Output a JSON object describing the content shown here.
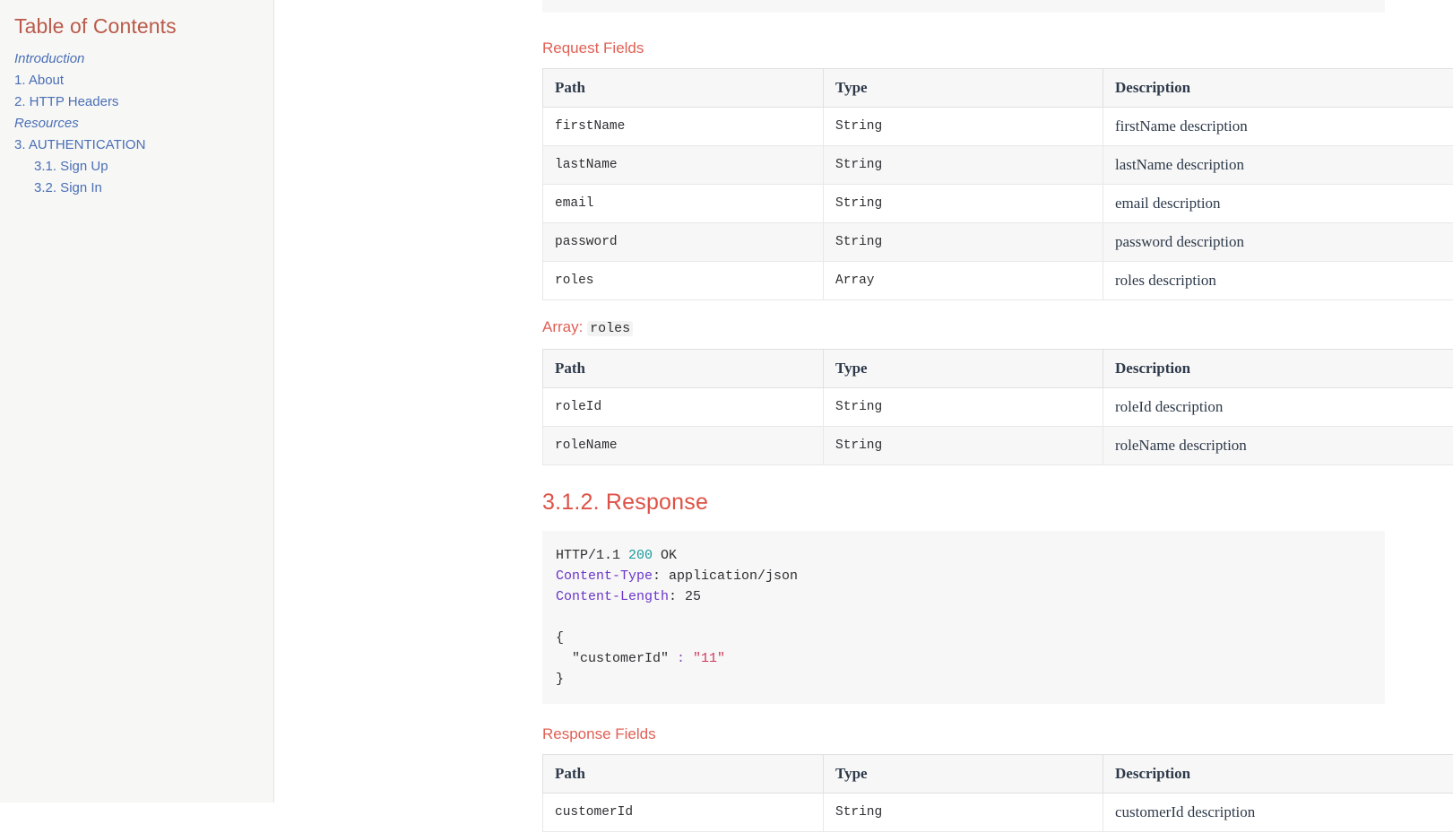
{
  "toc": {
    "title": "Table of Contents",
    "items": [
      {
        "label": "Introduction",
        "style": "italic",
        "level": 1
      },
      {
        "label": "1. About",
        "style": "link",
        "level": 1
      },
      {
        "label": "2. HTTP Headers",
        "style": "link",
        "level": 1
      },
      {
        "label": "Resources",
        "style": "italic",
        "level": 1
      },
      {
        "label": "3. AUTHENTICATION",
        "style": "link",
        "level": 1
      },
      {
        "label": "3.1. Sign Up",
        "style": "link",
        "level": 2
      },
      {
        "label": "3.2. Sign In",
        "style": "link",
        "level": 2
      }
    ]
  },
  "content": {
    "request_fields": {
      "label": "Request Fields",
      "columns": [
        "Path",
        "Type",
        "Description"
      ],
      "rows": [
        {
          "path": "firstName",
          "type": "String",
          "description": "firstName description"
        },
        {
          "path": "lastName",
          "type": "String",
          "description": "lastName description"
        },
        {
          "path": "email",
          "type": "String",
          "description": "email description"
        },
        {
          "path": "password",
          "type": "String",
          "description": "password description"
        },
        {
          "path": "roles",
          "type": "Array",
          "description": "roles description"
        }
      ]
    },
    "array_roles": {
      "label_prefix": "Array:",
      "label_code": "roles",
      "columns": [
        "Path",
        "Type",
        "Description"
      ],
      "rows": [
        {
          "path": "roleId",
          "type": "String",
          "description": "roleId description"
        },
        {
          "path": "roleName",
          "type": "String",
          "description": "roleName description"
        }
      ]
    },
    "response_section": {
      "heading": "3.1.2. Response",
      "code": {
        "status_line_prefix": "HTTP/1.1 ",
        "status_code": "200",
        "status_text": " OK",
        "header1_name": "Content-Type",
        "header1_value": ": application/json",
        "header2_name": "Content-Length",
        "header2_value": ": 25",
        "body_open": "{",
        "body_key": "  \"customerId\" ",
        "body_colon": ":",
        "body_value": " \"11\"",
        "body_close": "}"
      }
    },
    "response_fields": {
      "label": "Response Fields",
      "columns": [
        "Path",
        "Type",
        "Description"
      ],
      "rows": [
        {
          "path": "customerId",
          "type": "String",
          "description": "customerId description"
        }
      ]
    }
  },
  "colors": {
    "accent_heading": "#dd5247",
    "label_red": "#e06055",
    "toc_title": "#ba5a4a",
    "toc_link": "#4a6fb5",
    "table_header_text": "#2e3a4a",
    "code_bg": "#f7f7f7",
    "sidebar_bg": "#f7f7f6"
  }
}
